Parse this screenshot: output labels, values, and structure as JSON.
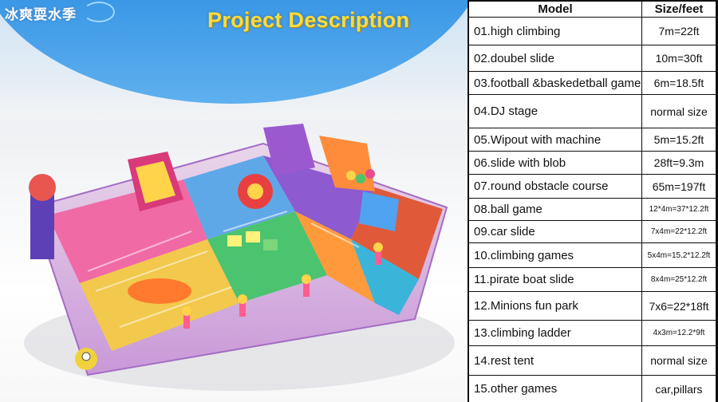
{
  "header": {
    "logo_text": "冰爽耍水季",
    "title": "Project Description"
  },
  "table": {
    "headers": {
      "model": "Model",
      "size": "Size/feet"
    },
    "rows": [
      {
        "model": "01.high climbing",
        "size": "7m=22ft",
        "small": false
      },
      {
        "model": "02.doubel slide",
        "size": "10m=30ft",
        "small": false
      },
      {
        "model": "03.football &baskedetball game",
        "size": "6m=18.5ft",
        "small": false
      },
      {
        "model": "04.DJ stage",
        "size": "normal size",
        "small": false
      },
      {
        "model": "05.Wipout with machine",
        "size": "5m=15.2ft",
        "small": false
      },
      {
        "model": "06.slide with blob",
        "size": "28ft=9.3m",
        "small": false
      },
      {
        "model": "07.round obstacle course",
        "size": "65m=197ft",
        "small": false
      },
      {
        "model": "08.ball game",
        "size": "12*4m=37*12.2ft",
        "small": true
      },
      {
        "model": "09.car slide",
        "size": "7x4m=22*12.2ft",
        "small": true
      },
      {
        "model": "10.climbing games",
        "size": "5x4m=15.2*12.2ft",
        "small": true
      },
      {
        "model": "11.pirate boat slide",
        "size": "8x4m=25*12.2ft",
        "small": true
      },
      {
        "model": "12.Minions  fun park",
        "size": "7x6=22*18ft",
        "small": false
      },
      {
        "model": "13.climbing ladder",
        "size": "4x3m=12.2*9ft",
        "small": true
      },
      {
        "model": "14.rest tent",
        "size": "normal size",
        "small": false
      },
      {
        "model": "15.other games",
        "size": "car,pillars",
        "small": false
      }
    ]
  },
  "colors": {
    "header_blue": "#3a97e6",
    "title_yellow": "#f6dc44",
    "table_border": "#0d0d0d"
  }
}
